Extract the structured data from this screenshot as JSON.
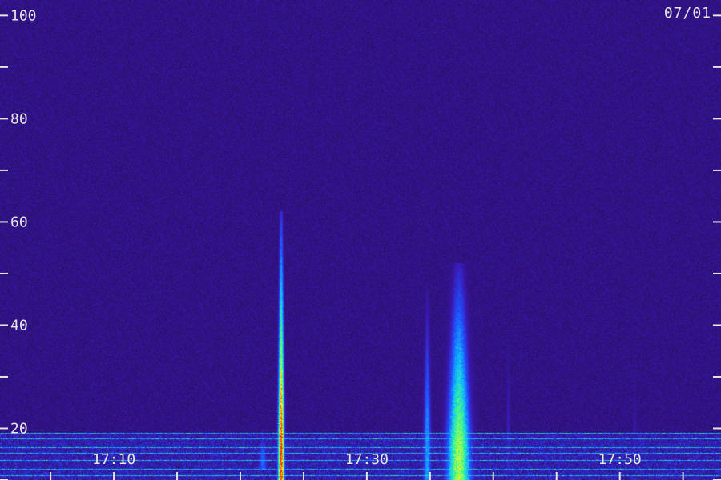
{
  "chart_data": {
    "type": "heatmap",
    "title": "",
    "date_label": "07/01",
    "xlabel": "",
    "ylabel": "",
    "xlim": [
      "17:01",
      "17:58"
    ],
    "ylim": [
      10,
      103
    ],
    "y_ticks": [
      {
        "value": 100,
        "label": "100"
      },
      {
        "value": 90,
        "label": ""
      },
      {
        "value": 80,
        "label": "80"
      },
      {
        "value": 70,
        "label": ""
      },
      {
        "value": 60,
        "label": "60"
      },
      {
        "value": 50,
        "label": ""
      },
      {
        "value": 40,
        "label": "40"
      },
      {
        "value": 30,
        "label": ""
      },
      {
        "value": 20,
        "label": "20"
      },
      {
        "value": 10,
        "label": ""
      }
    ],
    "x_ticks": [
      {
        "time": "17:05",
        "label": ""
      },
      {
        "time": "17:10",
        "label": "17:10"
      },
      {
        "time": "17:15",
        "label": ""
      },
      {
        "time": "17:20",
        "label": ""
      },
      {
        "time": "17:25",
        "label": ""
      },
      {
        "time": "17:30",
        "label": "17:30"
      },
      {
        "time": "17:35",
        "label": ""
      },
      {
        "time": "17:40",
        "label": ""
      },
      {
        "time": "17:45",
        "label": ""
      },
      {
        "time": "17:50",
        "label": "17:50"
      },
      {
        "time": "17:55",
        "label": ""
      }
    ],
    "colormap": [
      "#2a0f66",
      "#3a18b0",
      "#2050ff",
      "#10c0ff",
      "#40ff80",
      "#ffff20",
      "#ff2000"
    ],
    "noise_band": {
      "y_from": 10,
      "y_to": 19,
      "intensity": 0.3
    },
    "bursts": [
      {
        "t_start": "17:23",
        "t_end": "17:23.4",
        "f_low": 10,
        "f_high": 62,
        "peak_intensity": 1.0
      },
      {
        "t_start": "17:34.5",
        "t_end": "17:35",
        "f_low": 12,
        "f_high": 47,
        "peak_intensity": 0.45
      },
      {
        "t_start": "17:36.5",
        "t_end": "17:38",
        "f_low": 10,
        "f_high": 52,
        "peak_intensity": 0.75
      },
      {
        "t_start": "17:21.5",
        "t_end": "17:22",
        "f_low": 14,
        "f_high": 20,
        "peak_intensity": 0.35
      },
      {
        "t_start": "17:41",
        "t_end": "17:41.3",
        "f_low": 14,
        "f_high": 40,
        "peak_intensity": 0.2
      },
      {
        "t_start": "17:51",
        "t_end": "17:51.3",
        "f_low": 16,
        "f_high": 35,
        "peak_intensity": 0.15
      }
    ]
  }
}
